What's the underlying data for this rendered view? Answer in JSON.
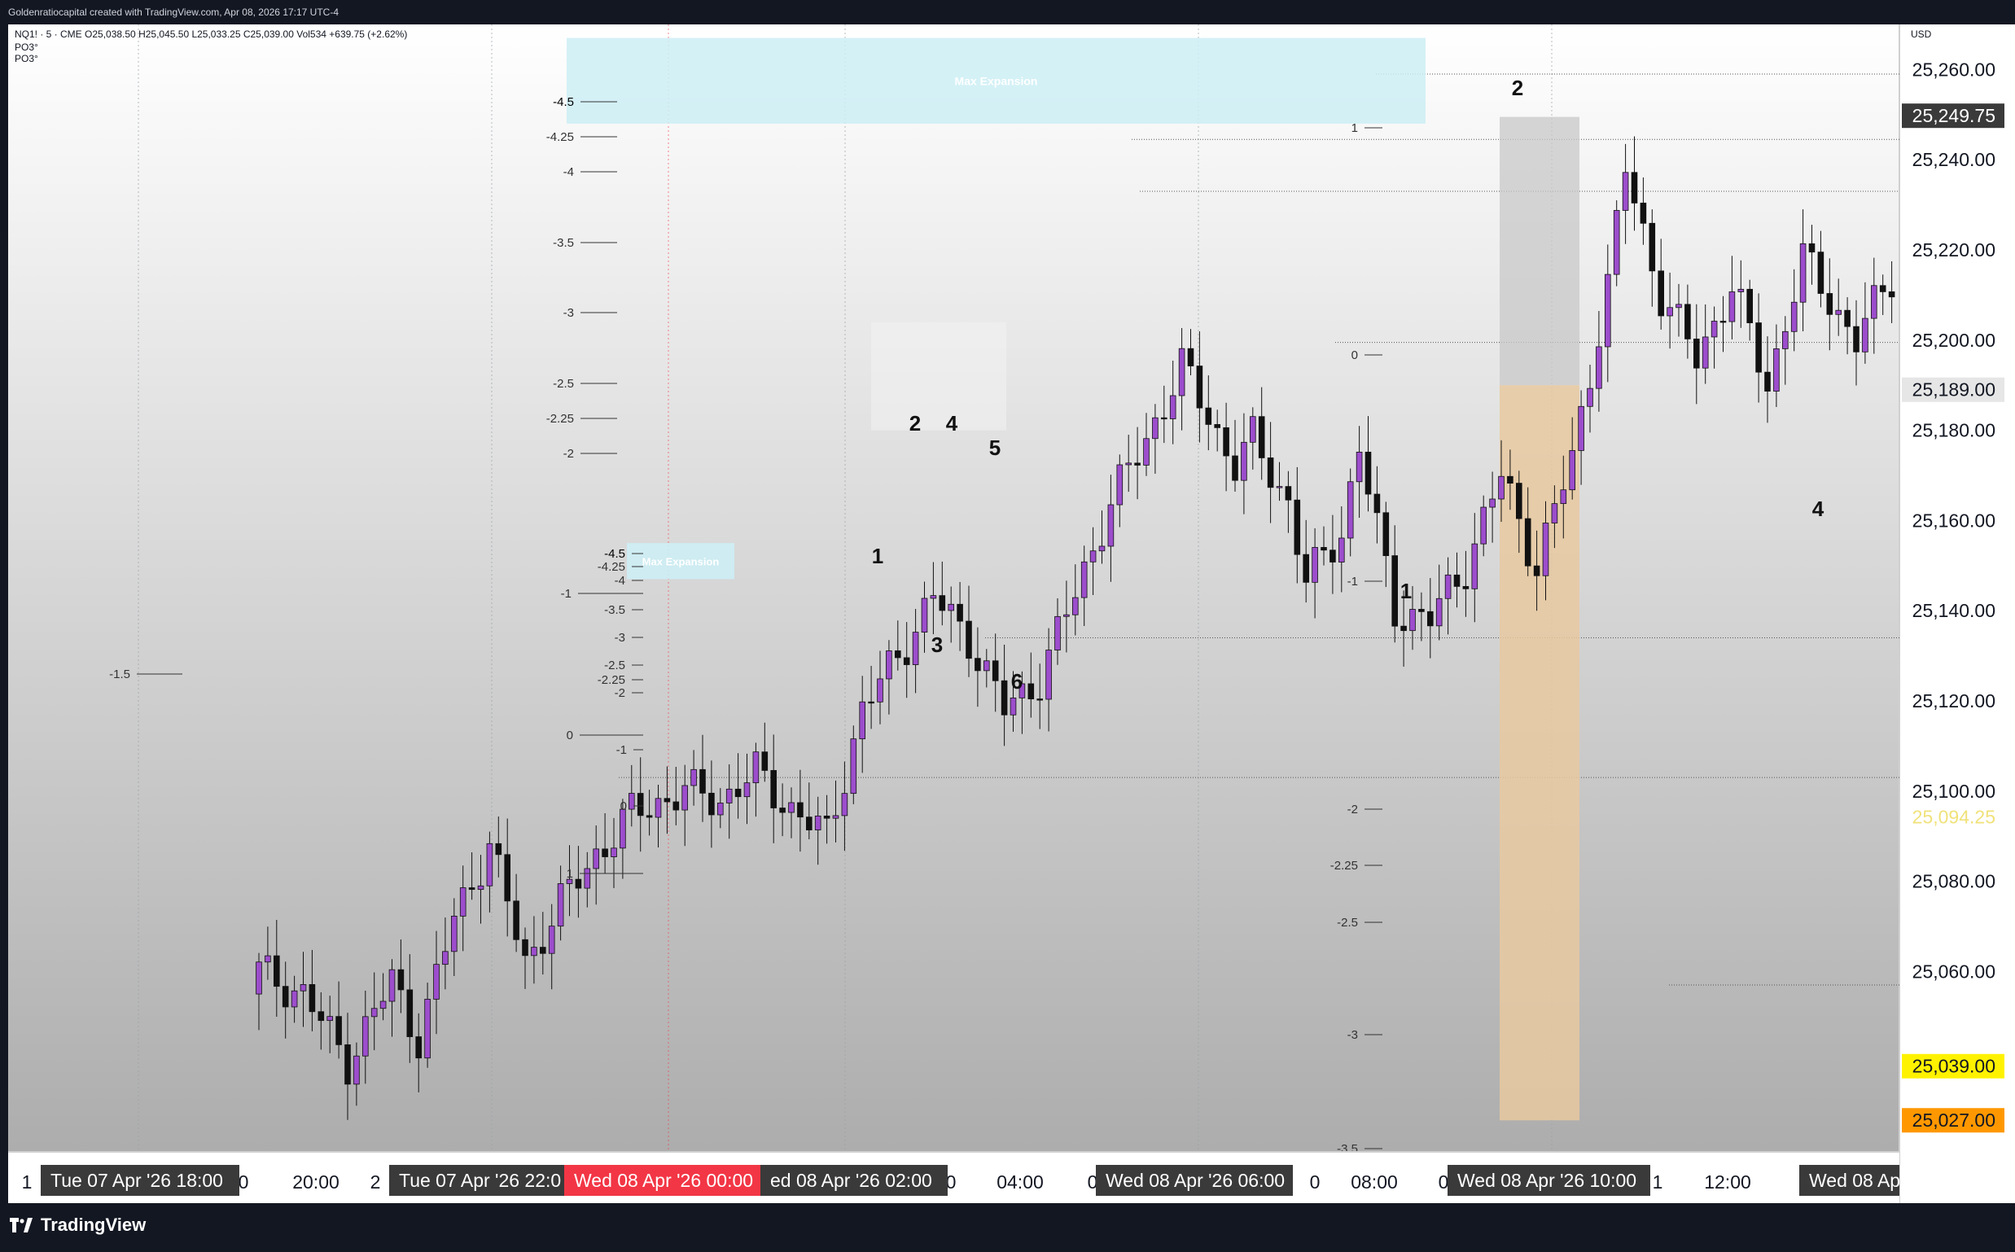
{
  "header": {
    "credit": "Goldenratiocapital created with TradingView.com, Apr 08, 2026 17:17 UTC-4",
    "symbol_line": "NQ1! · 5 · CME  O25,038.50  H25,045.50  L25,033.25  C25,039.00  Vol534  +639.75 (+2.62%)",
    "indicators": [
      "PO3°",
      "PO3°"
    ]
  },
  "branding": {
    "name": "TradingView",
    "logo_icon": "tradingview-logo-icon"
  },
  "colors": {
    "bull_candle": "#9c4dcc",
    "bear_candle": "#111111",
    "max_expansion_zone": "#cdeef5",
    "grey_zone": "#c8c8c8",
    "orange_zone": "#e8c9a0",
    "highlight_yellow": "#fff200",
    "highlight_orange": "#ff9800",
    "date_red": "#f23645"
  },
  "chart_data": {
    "type": "candlestick",
    "symbol": "NQ1!",
    "interval": "5",
    "exchange": "CME",
    "ohlc": {
      "open": 25038.5,
      "high": 25045.5,
      "low": 25033.25,
      "close": 25039.0,
      "volume": 534,
      "change": "+639.75 (+2.62%)"
    },
    "currency": "USD",
    "y_axis": {
      "min": 25020,
      "max": 25270,
      "ticks": [
        "25,260.00",
        "25,240.00",
        "25,220.00",
        "25,200.00",
        "25,180.00",
        "25,160.00",
        "25,140.00",
        "25,120.00",
        "25,100.00",
        "25,080.00",
        "25,060.00"
      ],
      "tick_values": [
        25260,
        25240,
        25220,
        25200,
        25180,
        25160,
        25140,
        25120,
        25100,
        25080,
        25060
      ]
    },
    "price_labels": [
      {
        "text": "25,249.75",
        "value": 25249.75,
        "style": "dark"
      },
      {
        "text": "25,189.00",
        "value": 25189.0,
        "style": "light"
      },
      {
        "text": "25,094.25",
        "value": 25094.25,
        "style": "faded"
      },
      {
        "text": "25,039.00",
        "value": 25039.0,
        "style": "yellow"
      },
      {
        "text": "25,027.00",
        "value": 25027.0,
        "style": "orange"
      }
    ],
    "time_axis": {
      "labels": [
        "20:00",
        "04:00",
        "08:00",
        "12:00"
      ],
      "boxed_labels": [
        {
          "text": "Tue 07 Apr '26   18:00",
          "style": "dark"
        },
        {
          "text": "Tue 07 Apr '26   22:0",
          "style": "dark"
        },
        {
          "text": "Wed 08 Apr '26   00:00",
          "style": "red"
        },
        {
          "text": "ed 08 Apr '26   02:00",
          "style": "dark"
        },
        {
          "text": "Wed 08 Apr '26   06:00",
          "style": "dark"
        },
        {
          "text": "Wed 08 Apr '26   10:00",
          "style": "dark"
        },
        {
          "text": "Wed 08 Ap",
          "style": "dark"
        }
      ],
      "edge_fragments": [
        "1",
        "0",
        "2",
        "0",
        "0",
        "0",
        "0",
        "1"
      ]
    },
    "horizontal_levels": [
      25259,
      25244.5,
      25233,
      25199.5,
      25134,
      25103,
      25057
    ],
    "zones": [
      {
        "label": "Max Expansion",
        "low": 25248,
        "high": 25267
      },
      {
        "label": "Max Expansion",
        "low": 25147,
        "high": 25155
      },
      {
        "label": "",
        "low": 25190,
        "high": 25249.5
      },
      {
        "label": "",
        "low": 25027,
        "high": 25190
      },
      {
        "label": "",
        "low": 25180,
        "high": 25204
      }
    ],
    "fib_ladders": [
      {
        "name": "upper-left",
        "levels": [
          "-4.5",
          "-4.25",
          "-4",
          "-3.5",
          "-3",
          "-2.5",
          "-2.25",
          "-2"
        ]
      },
      {
        "name": "middle-left",
        "levels": [
          "-4.5",
          "-4.25",
          "-4",
          "-1",
          "-3.5",
          "-3",
          "-2.5",
          "-2.25",
          "-2",
          "0",
          "-1",
          "0",
          "1"
        ]
      },
      {
        "name": "left",
        "levels": [
          "-1.5"
        ]
      },
      {
        "name": "right-top",
        "levels": [
          "1",
          "0",
          "-1"
        ]
      },
      {
        "name": "right-bottom",
        "levels": [
          "-2",
          "-2.25",
          "-2.5",
          "-3",
          "-3.5"
        ]
      }
    ],
    "wave_labels": [
      "1",
      "2",
      "4",
      "5",
      "3",
      "6",
      "2",
      "1",
      "4"
    ]
  }
}
